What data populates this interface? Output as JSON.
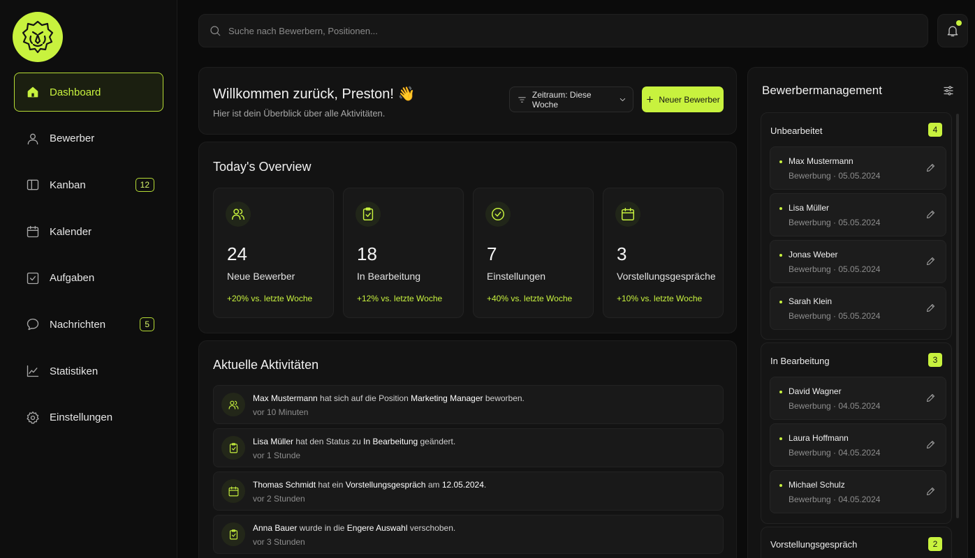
{
  "sidebar": {
    "logo_icon": "lion-head-logo",
    "items": [
      {
        "label": "Dashboard",
        "icon": "home-icon",
        "active": true,
        "badge": ""
      },
      {
        "label": "Bewerber",
        "icon": "user-icon",
        "badge": ""
      },
      {
        "label": "Kanban",
        "icon": "kanban-icon",
        "badge": "12"
      },
      {
        "label": "Kalender",
        "icon": "calendar-icon",
        "badge": ""
      },
      {
        "label": "Aufgaben",
        "icon": "checkbox-icon",
        "badge": ""
      },
      {
        "label": "Nachrichten",
        "icon": "chat-icon",
        "badge": "5"
      },
      {
        "label": "Statistiken",
        "icon": "chart-icon",
        "badge": ""
      },
      {
        "label": "Einstellungen",
        "icon": "gear-icon",
        "badge": ""
      }
    ]
  },
  "search": {
    "placeholder": "Suche nach Bewerbern, Positionen..."
  },
  "welcome": {
    "title": "Willkommen zurück, Preston! 👋",
    "subtitle": "Hier ist dein Überblick über alle Aktivitäten.",
    "period_label": "Zeitraum: Diese Woche",
    "new_label": "Neuer Bewerber"
  },
  "overview": {
    "title": "Today's Overview",
    "stats": [
      {
        "value": "24",
        "label": "Neue Bewerber",
        "trend": "+20% vs. letzte Woche",
        "icon": "users-icon"
      },
      {
        "value": "18",
        "label": "In Bearbeitung",
        "trend": "+12% vs. letzte Woche",
        "icon": "clipboard-check-icon"
      },
      {
        "value": "7",
        "label": "Einstellungen",
        "trend": "+40% vs. letzte Woche",
        "icon": "check-circle-icon"
      },
      {
        "value": "3",
        "label": "Vorstellungsgespräche",
        "trend": "+10% vs. letzte Woche",
        "icon": "calendar-icon"
      }
    ]
  },
  "activities": {
    "title": "Aktuelle Aktivitäten",
    "items": [
      {
        "icon": "users-icon",
        "parts": [
          [
            "Max Mustermann",
            true
          ],
          [
            " hat sich auf die Position ",
            false
          ],
          [
            "Marketing Manager",
            true
          ],
          [
            " beworben.",
            false
          ]
        ],
        "time": "vor 10 Minuten"
      },
      {
        "icon": "clipboard-check-icon",
        "parts": [
          [
            "Lisa Müller",
            true
          ],
          [
            " hat den Status zu ",
            false
          ],
          [
            "In Bearbeitung",
            true
          ],
          [
            " geändert.",
            false
          ]
        ],
        "time": "vor 1 Stunde"
      },
      {
        "icon": "calendar-icon",
        "parts": [
          [
            "Thomas Schmidt",
            true
          ],
          [
            " hat ein ",
            false
          ],
          [
            "Vorstellungsgespräch",
            true
          ],
          [
            " am ",
            false
          ],
          [
            "12.05.2024",
            true
          ],
          [
            ".",
            false
          ]
        ],
        "time": "vor 2 Stunden"
      },
      {
        "icon": "clipboard-check-icon",
        "parts": [
          [
            "Anna Bauer",
            true
          ],
          [
            " wurde in die ",
            false
          ],
          [
            "Engere Auswahl",
            true
          ],
          [
            " verschoben.",
            false
          ]
        ],
        "time": "vor 3 Stunden"
      }
    ]
  },
  "management": {
    "title": "Bewerbermanagement",
    "groups": [
      {
        "title": "Unbearbeitet",
        "count": "4",
        "cards": [
          {
            "name": "Max Mustermann",
            "meta": "Bewerbung · 05.05.2024"
          },
          {
            "name": "Lisa Müller",
            "meta": "Bewerbung · 05.05.2024"
          },
          {
            "name": "Jonas Weber",
            "meta": "Bewerbung · 05.05.2024"
          },
          {
            "name": "Sarah Klein",
            "meta": "Bewerbung · 05.05.2024"
          }
        ]
      },
      {
        "title": "In Bearbeitung",
        "count": "3",
        "cards": [
          {
            "name": "David Wagner",
            "meta": "Bewerbung · 04.05.2024"
          },
          {
            "name": "Laura Hoffmann",
            "meta": "Bewerbung · 04.05.2024"
          },
          {
            "name": "Michael Schulz",
            "meta": "Bewerbung · 04.05.2024"
          }
        ]
      },
      {
        "title": "Vorstellungsgespräch",
        "count": "2",
        "cards": []
      }
    ]
  },
  "colors": {
    "accent": "#c8f23e",
    "background": "#0b0b0b",
    "panel": "#131313"
  }
}
